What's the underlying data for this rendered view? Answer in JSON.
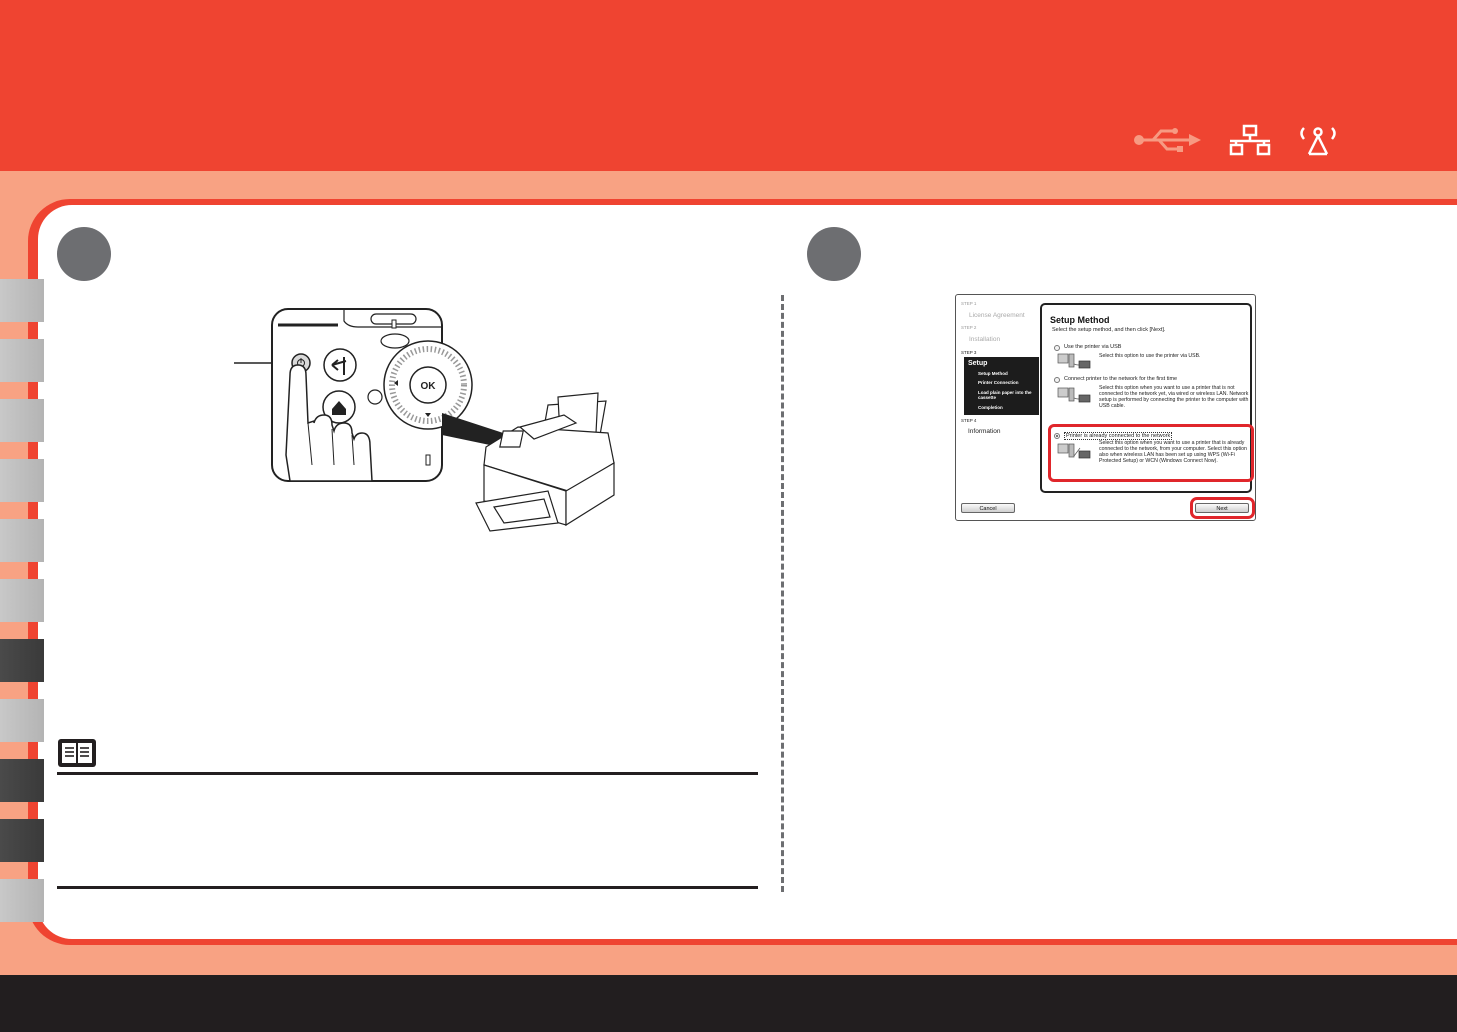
{
  "header": {
    "connection_icons": [
      "usb-icon",
      "wired-lan-icon",
      "wireless-lan-icon"
    ],
    "bg_color": "#ef4431",
    "icon_color_active": "#ffffff",
    "icon_color_inactive": "#f79a82"
  },
  "sidebar_tabs": [
    {
      "state": "inactive"
    },
    {
      "state": "inactive"
    },
    {
      "state": "inactive"
    },
    {
      "state": "inactive"
    },
    {
      "state": "inactive"
    },
    {
      "state": "inactive"
    },
    {
      "state": "active"
    },
    {
      "state": "inactive"
    },
    {
      "state": "active"
    },
    {
      "state": "active"
    },
    {
      "state": "inactive"
    }
  ],
  "step_left": {
    "panel_labels": {
      "ok": "OK"
    }
  },
  "installer": {
    "steps": [
      {
        "step": "STEP 1",
        "name": "License Agreement"
      },
      {
        "step": "STEP 2",
        "name": "Installation"
      },
      {
        "step": "STEP 3",
        "name": "Setup",
        "substeps": [
          "Setup Method",
          "Printer Connection",
          "Load plain paper into the",
          "cassette",
          "Completion"
        ]
      },
      {
        "step": "STEP 4",
        "name": "Information"
      }
    ],
    "title": "Setup Method",
    "subtitle": "Select the setup method, and then click [Next].",
    "options": [
      {
        "label": "Use the printer via USB",
        "description": "Select this option to use the printer via USB.",
        "selected": false
      },
      {
        "label": "Connect printer to the network for the first time",
        "description": "Select this option when you want to use a printer that is not connected to the network yet, via wired or wireless LAN. Network setup is performed by connecting the printer to the computer with USB cable.",
        "selected": false
      },
      {
        "label": "Printer is already connected to the network",
        "description": "Select this option when you want to use a printer that is already connected to the network, from your computer. Select this option also when wireless LAN has been set up using WPS (Wi-Fi Protected Setup) or WCN (Windows Connect Now).",
        "selected": true
      }
    ],
    "cancel_label": "Cancel",
    "next_label": "Next"
  },
  "note_icon": "book-icon",
  "highlight_color": "#e0262b"
}
